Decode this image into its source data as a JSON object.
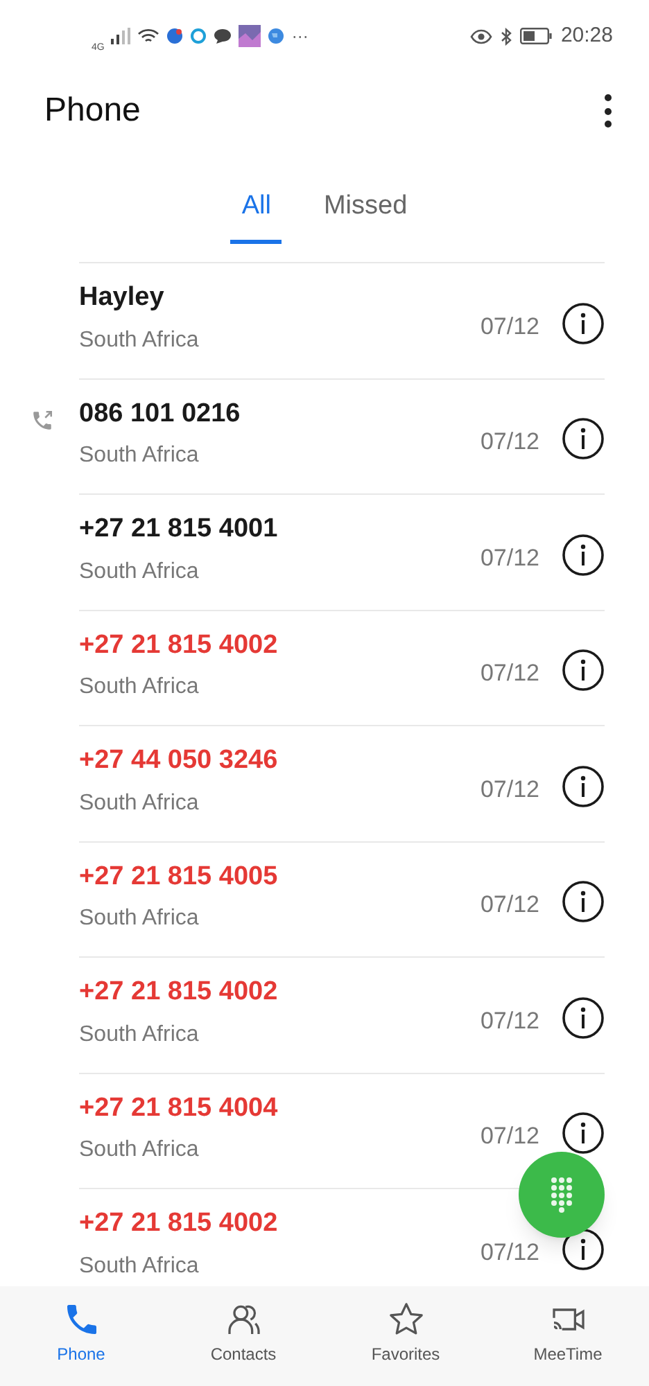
{
  "status_bar": {
    "network": "4G",
    "more": "···",
    "time": "20:28"
  },
  "header": {
    "title": "Phone"
  },
  "tabs": [
    {
      "label": "All",
      "selected": true
    },
    {
      "label": "Missed",
      "selected": false
    }
  ],
  "calls": [
    {
      "name": "Hayley",
      "location": "South Africa",
      "date": "07/12",
      "missed": false,
      "outgoing": false
    },
    {
      "name": "086 101 0216",
      "location": "South Africa",
      "date": "07/12",
      "missed": false,
      "outgoing": true
    },
    {
      "name": "+27 21 815 4001",
      "location": "South Africa",
      "date": "07/12",
      "missed": false,
      "outgoing": false
    },
    {
      "name": "+27 21 815 4002",
      "location": "South Africa",
      "date": "07/12",
      "missed": true,
      "outgoing": false
    },
    {
      "name": "+27 44 050 3246",
      "location": "South Africa",
      "date": "07/12",
      "missed": true,
      "outgoing": false
    },
    {
      "name": "+27 21 815 4005",
      "location": "South Africa",
      "date": "07/12",
      "missed": true,
      "outgoing": false
    },
    {
      "name": "+27 21 815 4002",
      "location": "South Africa",
      "date": "07/12",
      "missed": true,
      "outgoing": false
    },
    {
      "name": "+27 21 815 4004",
      "location": "South Africa",
      "date": "07/12",
      "missed": true,
      "outgoing": false
    },
    {
      "name": "+27 21 815 4002",
      "location": "South Africa",
      "date": "07/12",
      "missed": true,
      "outgoing": false
    }
  ],
  "bottom_nav": [
    {
      "label": "Phone",
      "kind": "phone",
      "selected": true
    },
    {
      "label": "Contacts",
      "kind": "contacts",
      "selected": false
    },
    {
      "label": "Favorites",
      "kind": "star",
      "selected": false
    },
    {
      "label": "MeeTime",
      "kind": "video",
      "selected": false
    }
  ]
}
